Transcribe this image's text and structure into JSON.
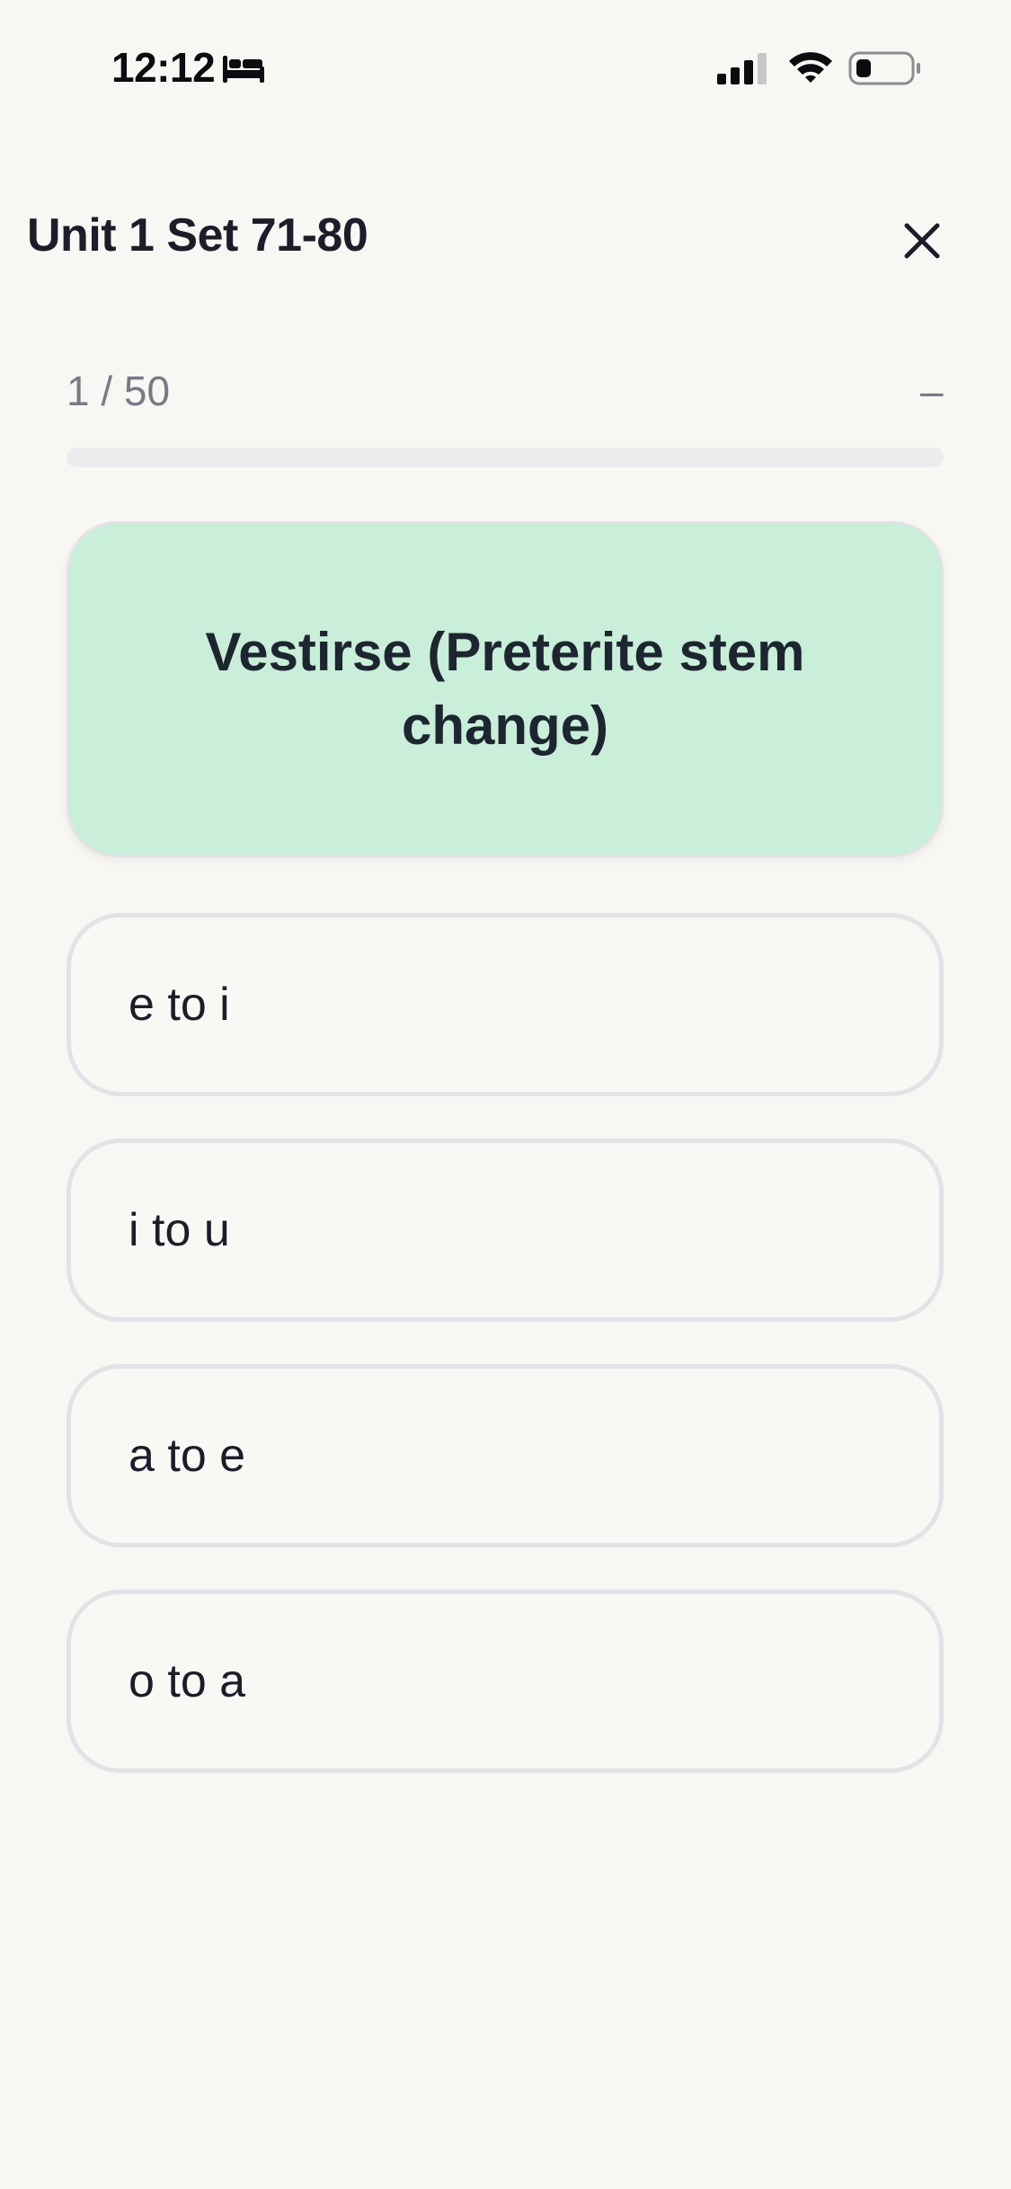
{
  "status_bar": {
    "time": "12:12",
    "sleep_icon": "bed-icon",
    "signal_icon": "cellular-signal-icon",
    "wifi_icon": "wifi-icon",
    "battery_icon": "battery-low-icon"
  },
  "header": {
    "title": "Unit 1 Set 71-80",
    "close_icon": "close-icon"
  },
  "progress": {
    "counter": "1 / 50",
    "indicator": "–",
    "fraction": 0
  },
  "question": {
    "prompt": "Vestirse (Preterite stem change)"
  },
  "answers": [
    {
      "label": "e to i"
    },
    {
      "label": "i to u"
    },
    {
      "label": "a to e"
    },
    {
      "label": "o to a"
    }
  ],
  "colors": {
    "background": "#f9f7f4",
    "card": "#c9eed9",
    "option_border": "#e3e2e6",
    "track": "#ececef",
    "text": "#1d1d2a",
    "muted": "#7a7a86"
  }
}
